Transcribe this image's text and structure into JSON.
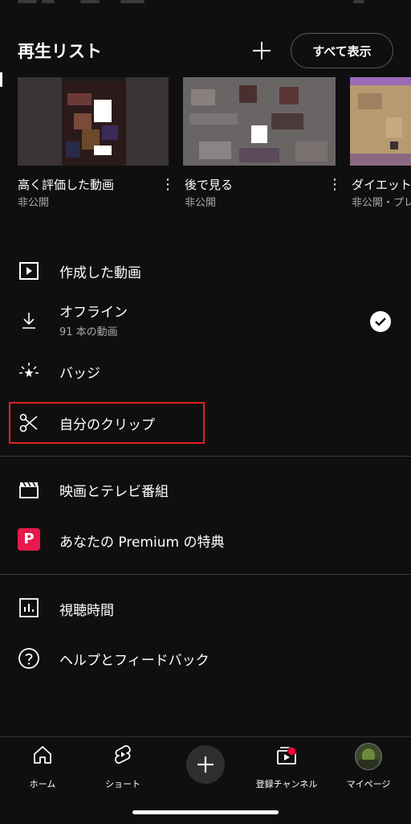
{
  "header": {
    "title": "再生リスト",
    "plus_icon": "plus-icon",
    "show_all_label": "すべて表示"
  },
  "playlists": [
    {
      "title": "高く評価した動画",
      "subtitle": "非公開"
    },
    {
      "title": "後で見る",
      "subtitle": "非公開"
    },
    {
      "title": "ダイエット",
      "subtitle": "非公開・プレ"
    }
  ],
  "menu": {
    "created_videos": "作成した動画",
    "offline": "オフライン",
    "offline_sub": "91 本の動画",
    "badges": "バッジ",
    "my_clips": "自分のクリップ",
    "movies_tv": "映画とテレビ番組",
    "premium": "あなたの Premium の特典",
    "premium_icon_letter": "P",
    "watch_time": "視聴時間",
    "help": "ヘルプとフィードバック"
  },
  "bottom_nav": {
    "home": "ホーム",
    "shorts": "ショート",
    "subscriptions": "登録チャンネル",
    "you": "マイページ"
  },
  "colors": {
    "background": "#0f0f0f",
    "highlight_border": "#e01f1f",
    "premium_red": "#e8194c",
    "notification": "#ff0033"
  }
}
